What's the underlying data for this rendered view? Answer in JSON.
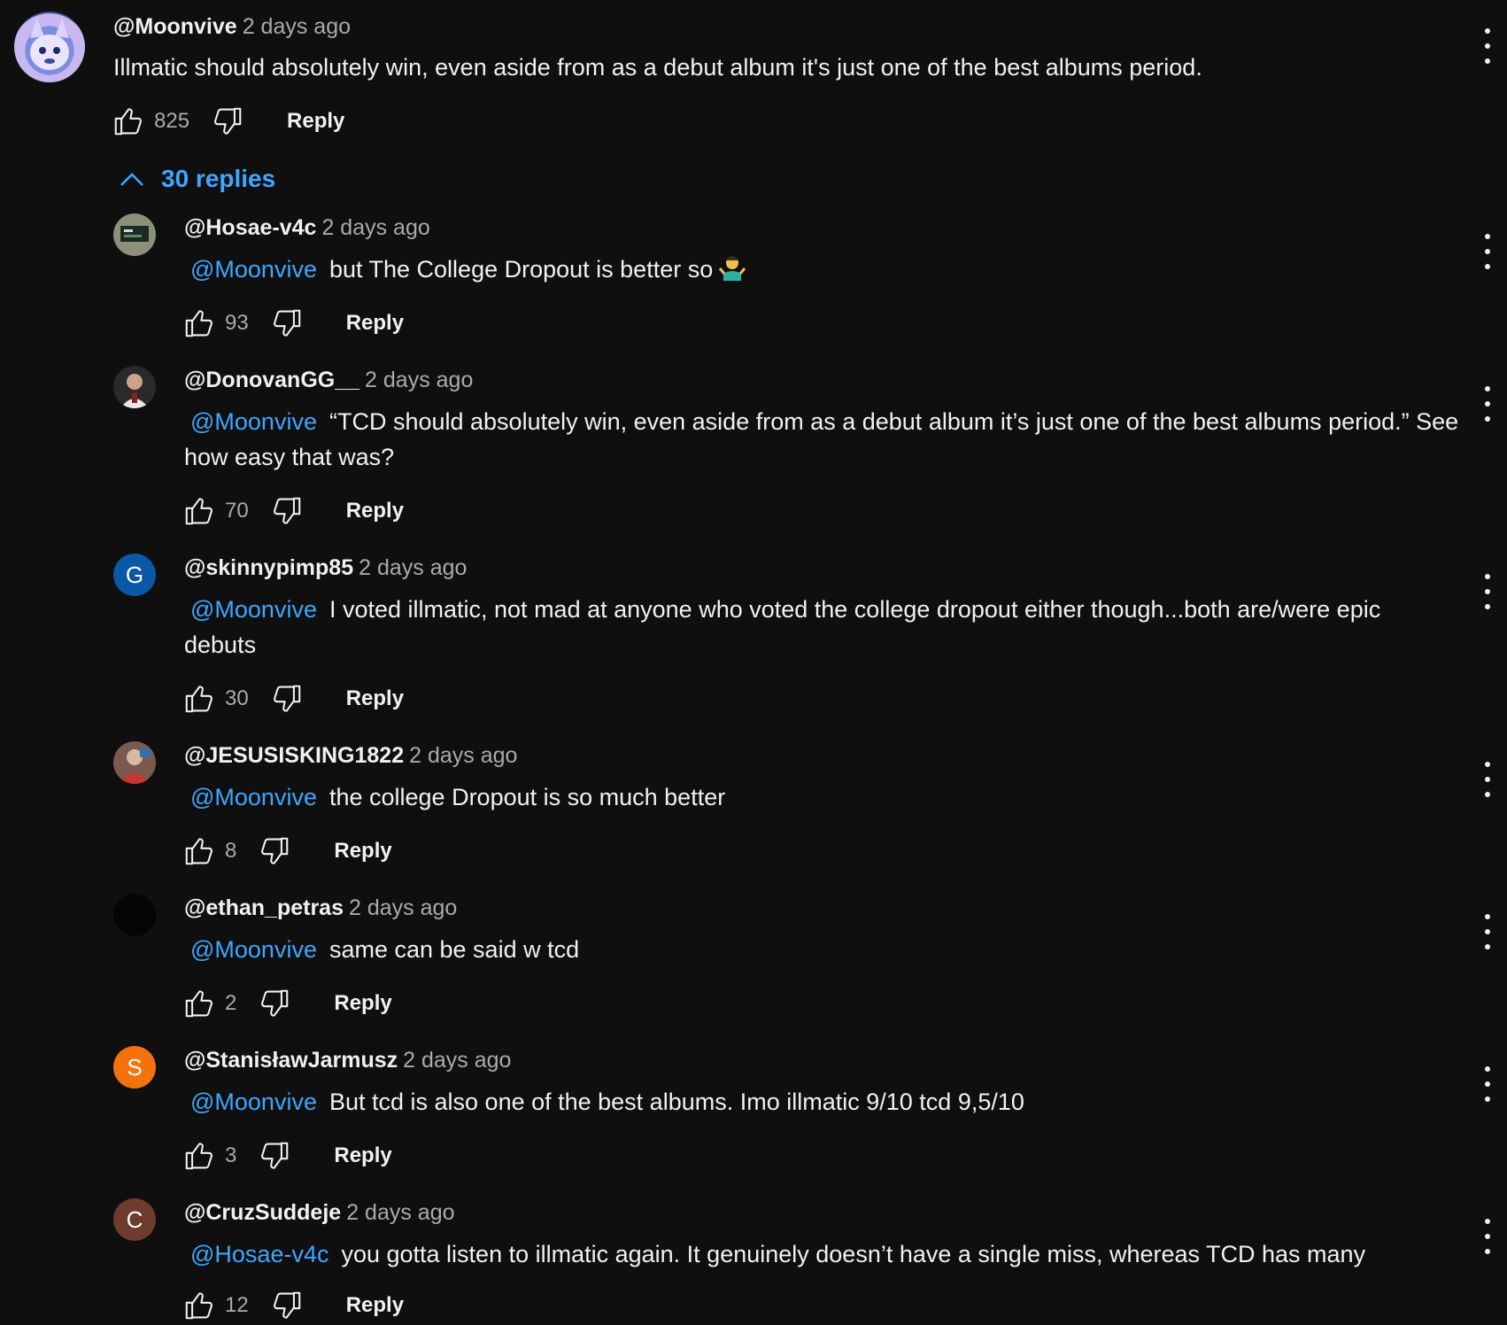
{
  "top_comment": {
    "author": "@Moonvive",
    "time": "2 days ago",
    "text": "Illmatic should absolutely win, even aside from as a debut album it's just one of the best albums period.",
    "likes": "825",
    "reply_label": "Reply",
    "avatar_icon": "anime-avatar-icon"
  },
  "replies_toggle": {
    "label": "30 replies",
    "icon": "chevron-up-icon"
  },
  "replies": [
    {
      "author": "@Hosae-v4c",
      "time": "2 days ago",
      "mention": "@Moonvive",
      "text": "but The College Dropout is better so",
      "likes": "93",
      "reply_label": "Reply",
      "avatar_letter": "",
      "avatar_color": "#6b6f5e",
      "emoji": "person-shrugging-emoji"
    },
    {
      "author": "@DonovanGG__",
      "time": "2 days ago",
      "mention": "@Moonvive",
      "text": "“TCD should absolutely win, even aside from as a debut album it’s just one of the best albums period.” See how easy that was?",
      "likes": "70",
      "reply_label": "Reply",
      "avatar_letter": "",
      "avatar_color": "#3b3430"
    },
    {
      "author": "@skinnypimp85",
      "time": "2 days ago",
      "mention": "@Moonvive",
      "text": "I voted illmatic, not mad at anyone who voted the college dropout either though...both are/were epic debuts",
      "likes": "30",
      "reply_label": "Reply",
      "avatar_letter": "G",
      "avatar_color": "#0b57a8"
    },
    {
      "author": "@JESUSISKING1822",
      "time": "2 days ago",
      "mention": "@Moonvive",
      "text": "the college Dropout is so much better",
      "likes": "8",
      "reply_label": "Reply",
      "avatar_letter": "",
      "avatar_color": "#b8483e"
    },
    {
      "author": "@ethan_petras",
      "time": "2 days ago",
      "mention": "@Moonvive",
      "text": "same can be said w tcd",
      "likes": "2",
      "reply_label": "Reply",
      "avatar_letter": "",
      "avatar_color": "#050505"
    },
    {
      "author": "@StanisławJarmusz",
      "time": "2 days ago",
      "mention": "@Moonvive",
      "text": "But tcd is also one of the best albums. Imo illmatic 9/10 tcd 9,5/10",
      "likes": "3",
      "reply_label": "Reply",
      "avatar_letter": "S",
      "avatar_color": "#f4720b"
    },
    {
      "author": "@CruzSuddeje",
      "time": "2 days ago",
      "mention": "@Hosae-v4c",
      "text": "you gotta listen to illmatic again. It genuinely doesn’t have a single miss, whereas TCD has many",
      "likes": "12",
      "reply_label": "Reply",
      "avatar_letter": "C",
      "avatar_color": "#6e3b2d"
    }
  ],
  "colors": {
    "background": "#0f0f0f",
    "text": "#f1f1f1",
    "muted": "#aaaaaa",
    "link": "#3ea6ff"
  },
  "icons": {
    "like": "thumbs-up-icon",
    "dislike": "thumbs-down-icon",
    "more": "more-vertical-icon"
  }
}
